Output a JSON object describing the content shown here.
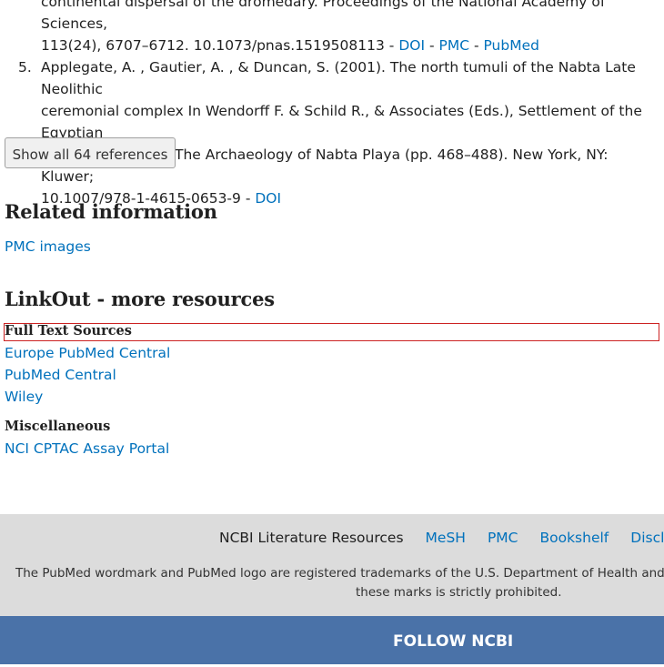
{
  "references": {
    "prev_tail": [
      "continental dispersal of the dromedary. Proceedings of the National Academy of Sciences,",
      "113(24), 6707–6712. 10.1073/pnas.1519508113 - "
    ],
    "prev_links": [
      "DOI",
      "PMC",
      "PubMed"
    ],
    "item5": {
      "num": "5.",
      "lines": [
        "Applegate, A. , Gautier, A. , & Duncan, S. (2001). The north tumuli of the Nabta Late Neolithic",
        "ceremonial complex In Wendorff F. & Schild R., & Associates (Eds.), Settlement of the Egyptian",
        "Sahara. Volume 1: The Archaeology of Nabta Playa (pp. 468–488). New York, NY: Kluwer;",
        "10.1007/978-1-4615-0653-9 - "
      ],
      "link": "DOI"
    },
    "separator": " - ",
    "show_all_label": "Show all 64 references"
  },
  "related": {
    "heading": "Related information",
    "links": [
      "PMC images"
    ]
  },
  "linkout": {
    "heading": "LinkOut - more resources",
    "full_text_heading": "Full Text Sources",
    "full_text_links": [
      "Europe PubMed Central",
      "PubMed Central",
      "Wiley"
    ],
    "misc_heading": "Miscellaneous",
    "misc_links": [
      "NCI CPTAC Assay Portal"
    ]
  },
  "footer": {
    "nav_title": "NCBI Literature Resources",
    "nav_links": [
      "MeSH",
      "PMC",
      "Bookshelf",
      "Disclaimer"
    ],
    "note_line1": "The PubMed wordmark and PubMed logo are registered trademarks of the U.S. Department of Health and Human Services. Unauthorized use of",
    "note_line2": "these marks is strictly prohibited.",
    "follow_label": "FOLLOW NCBI"
  },
  "colors": {
    "link": "#0071bc",
    "footer_bg": "#dcdcdc",
    "follow_bg": "#4a72a8",
    "highlight": "#cc2222"
  }
}
